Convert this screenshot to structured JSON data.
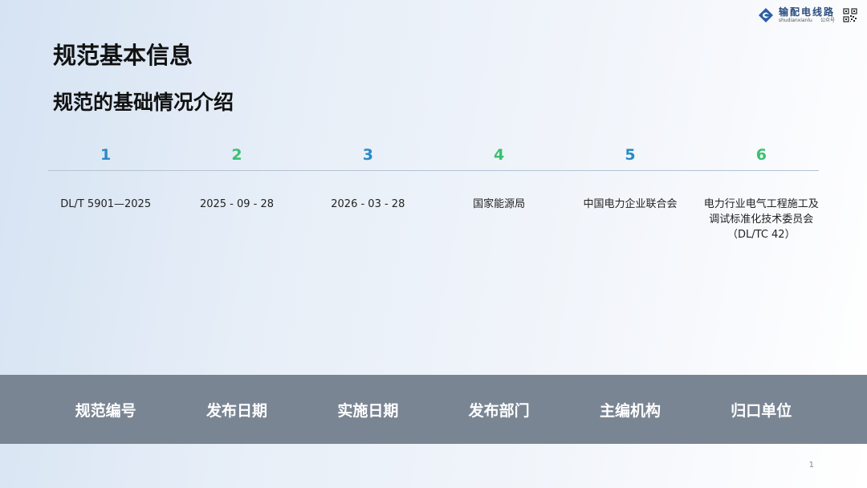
{
  "logo": {
    "name": "输配电线路",
    "sub_left": "shudianxianlu",
    "sub_right": "公众号"
  },
  "title": "规范基本信息",
  "subtitle": "规范的基础情况介绍",
  "columns": [
    {
      "number": "1",
      "number_color": "#2a8ac6",
      "value": "DL/T 5901—2025",
      "label": "规范编号"
    },
    {
      "number": "2",
      "number_color": "#3cbf72",
      "value": "2025 - 09 - 28",
      "label": "发布日期"
    },
    {
      "number": "3",
      "number_color": "#2a8ac6",
      "value": "2026 - 03 - 28",
      "label": "实施日期"
    },
    {
      "number": "4",
      "number_color": "#3cbf72",
      "value": "国家能源局",
      "label": "发布部门"
    },
    {
      "number": "5",
      "number_color": "#2a8ac6",
      "value": "中国电力企业联合会",
      "label": "主编机构"
    },
    {
      "number": "6",
      "number_color": "#3cbf72",
      "value": "电力行业电气工程施工及调试标准化技术委员会（DL/TC 42）",
      "label": "归口单位"
    }
  ],
  "band_color": "#7a8594",
  "page_number": "1"
}
